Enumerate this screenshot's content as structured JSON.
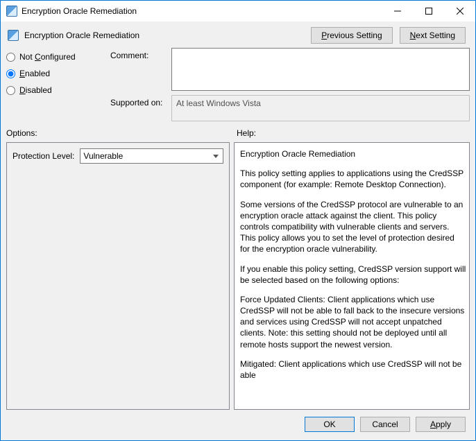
{
  "window": {
    "title": "Encryption Oracle Remediation",
    "heading": "Encryption Oracle Remediation"
  },
  "nav": {
    "previous": "Previous Setting",
    "next": "Next Setting"
  },
  "state": {
    "not_configured": "Not Configured",
    "enabled": "Enabled",
    "disabled": "Disabled",
    "selected": "enabled"
  },
  "fields": {
    "comment_label": "Comment:",
    "comment_value": "",
    "supported_label": "Supported on:",
    "supported_value": "At least Windows Vista"
  },
  "sections": {
    "options_label": "Options:",
    "help_label": "Help:"
  },
  "options": {
    "protection_level_label": "Protection Level:",
    "protection_level_value": "Vulnerable"
  },
  "help": {
    "p1": "Encryption Oracle Remediation",
    "p2": "This policy setting applies to applications using the CredSSP component (for example: Remote Desktop Connection).",
    "p3": "Some versions of the CredSSP protocol are vulnerable to an encryption oracle attack against the client.  This policy controls compatibility with vulnerable clients and servers.  This policy allows you to set the level of protection desired for the encryption oracle vulnerability.",
    "p4": "If you enable this policy setting, CredSSP version support will be selected based on the following options:",
    "p5": "Force Updated Clients: Client applications which use CredSSP will not be able to fall back to the insecure versions and services using CredSSP will not accept unpatched clients. Note: this setting should not be deployed until all remote hosts support the newest version.",
    "p6": "Mitigated: Client applications which use CredSSP will not be able"
  },
  "buttons": {
    "ok": "OK",
    "cancel": "Cancel",
    "apply": "Apply"
  }
}
